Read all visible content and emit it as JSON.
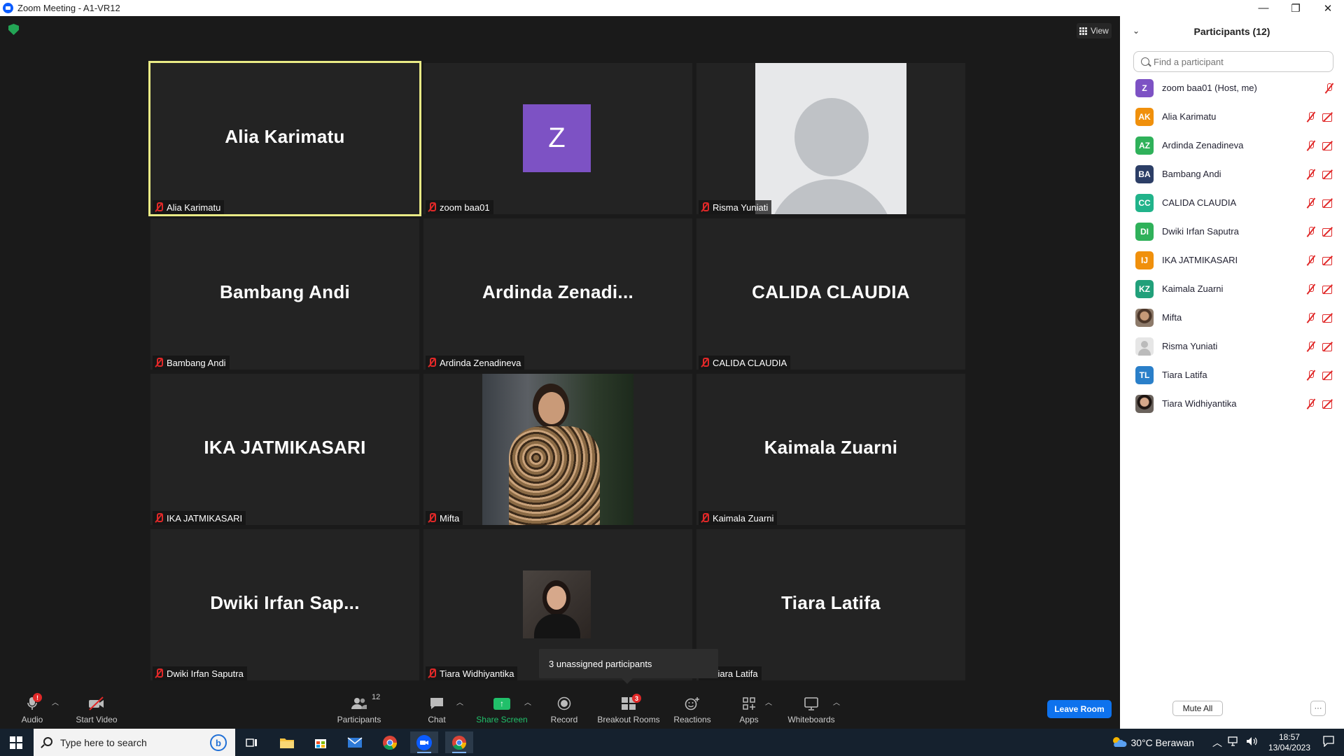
{
  "window": {
    "title": "Zoom Meeting - A1-VR12"
  },
  "meeting": {
    "view_label": "View",
    "tiles": [
      {
        "big_name": "Alia Karimatu",
        "label": "Alia Karimatu",
        "kind": "name",
        "active": true
      },
      {
        "big_name": "",
        "label": "zoom baa01",
        "kind": "letter",
        "letter": "Z"
      },
      {
        "big_name": "",
        "label": "Risma Yuniati",
        "kind": "silhouette"
      },
      {
        "big_name": "Bambang Andi",
        "label": "Bambang Andi",
        "kind": "name"
      },
      {
        "big_name": "Ardinda  Zenadi...",
        "label": "Ardinda Zenadineva",
        "kind": "name"
      },
      {
        "big_name": "CALIDA CLAUDIA",
        "label": "CALIDA CLAUDIA",
        "kind": "name"
      },
      {
        "big_name": "IKA JATMIKASARI",
        "label": "IKA JATMIKASARI",
        "kind": "name"
      },
      {
        "big_name": "",
        "label": "Mifta",
        "kind": "photo"
      },
      {
        "big_name": "Kaimala Zuarni",
        "label": "Kaimala Zuarni",
        "kind": "name"
      },
      {
        "big_name": "Dwiki Irfan Sap...",
        "label": "Dwiki Irfan Saputra",
        "kind": "name"
      },
      {
        "big_name": "",
        "label": "Tiara Widhiyantika",
        "kind": "small_photo"
      },
      {
        "big_name": "Tiara Latifa",
        "label": "Tiara Latifa",
        "kind": "name"
      }
    ],
    "tooltip": "3 unassigned participants"
  },
  "toolbar": {
    "audio": "Audio",
    "audio_badge": "!",
    "start_video": "Start Video",
    "participants": "Participants",
    "participants_count": "12",
    "chat": "Chat",
    "share_screen": "Share Screen",
    "record": "Record",
    "breakout_rooms": "Breakout Rooms",
    "breakout_badge": "3",
    "reactions": "Reactions",
    "apps": "Apps",
    "whiteboards": "Whiteboards",
    "leave_room": "Leave Room"
  },
  "panel": {
    "title": "Participants (12)",
    "search_placeholder": "Find a participant",
    "participants": [
      {
        "initials": "Z",
        "name": "zoom baa01 (Host, me)",
        "color": "#7d52c4",
        "video_off": false
      },
      {
        "initials": "AK",
        "name": "Alia Karimatu",
        "color": "#f0900c",
        "video_off": true
      },
      {
        "initials": "AZ",
        "name": "Ardinda Zenadineva",
        "color": "#2fb15a",
        "video_off": true
      },
      {
        "initials": "BA",
        "name": "Bambang Andi",
        "color": "#2c3e66",
        "video_off": true
      },
      {
        "initials": "CC",
        "name": "CALIDA CLAUDIA",
        "color": "#21b38a",
        "video_off": true
      },
      {
        "initials": "DI",
        "name": "Dwiki Irfan Saputra",
        "color": "#2fb15a",
        "video_off": true
      },
      {
        "initials": "IJ",
        "name": "IKA JATMIKASARI",
        "color": "#f0900c",
        "video_off": true
      },
      {
        "initials": "KZ",
        "name": "Kaimala Zuarni",
        "color": "#21a07a",
        "video_off": true
      },
      {
        "initials": "",
        "name": "Mifta",
        "avatar": "photo1",
        "video_off": true
      },
      {
        "initials": "",
        "name": "Risma Yuniati",
        "avatar": "gray",
        "video_off": true
      },
      {
        "initials": "TL",
        "name": "Tiara Latifa",
        "color": "#2a7fc9",
        "video_off": true
      },
      {
        "initials": "",
        "name": "Tiara Widhiyantika",
        "avatar": "photo2",
        "video_off": true
      }
    ],
    "mute_all": "Mute All",
    "more": "···"
  },
  "taskbar": {
    "search_placeholder": "Type here to search",
    "weather": "30°C  Berawan",
    "time": "18:57",
    "date": "13/04/2023"
  }
}
